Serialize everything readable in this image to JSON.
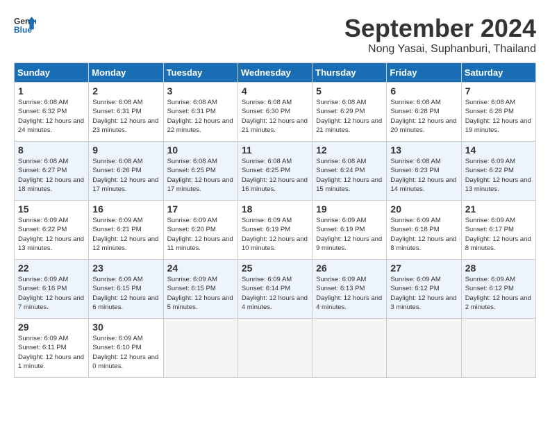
{
  "header": {
    "logo_line1": "General",
    "logo_line2": "Blue",
    "month_title": "September 2024",
    "location": "Nong Yasai, Suphanburi, Thailand"
  },
  "weekdays": [
    "Sunday",
    "Monday",
    "Tuesday",
    "Wednesday",
    "Thursday",
    "Friday",
    "Saturday"
  ],
  "weeks": [
    [
      {
        "day": "1",
        "sunrise": "6:08 AM",
        "sunset": "6:32 PM",
        "daylight": "12 hours and 24 minutes."
      },
      {
        "day": "2",
        "sunrise": "6:08 AM",
        "sunset": "6:31 PM",
        "daylight": "12 hours and 23 minutes."
      },
      {
        "day": "3",
        "sunrise": "6:08 AM",
        "sunset": "6:31 PM",
        "daylight": "12 hours and 22 minutes."
      },
      {
        "day": "4",
        "sunrise": "6:08 AM",
        "sunset": "6:30 PM",
        "daylight": "12 hours and 21 minutes."
      },
      {
        "day": "5",
        "sunrise": "6:08 AM",
        "sunset": "6:29 PM",
        "daylight": "12 hours and 21 minutes."
      },
      {
        "day": "6",
        "sunrise": "6:08 AM",
        "sunset": "6:28 PM",
        "daylight": "12 hours and 20 minutes."
      },
      {
        "day": "7",
        "sunrise": "6:08 AM",
        "sunset": "6:28 PM",
        "daylight": "12 hours and 19 minutes."
      }
    ],
    [
      {
        "day": "8",
        "sunrise": "6:08 AM",
        "sunset": "6:27 PM",
        "daylight": "12 hours and 18 minutes."
      },
      {
        "day": "9",
        "sunrise": "6:08 AM",
        "sunset": "6:26 PM",
        "daylight": "12 hours and 17 minutes."
      },
      {
        "day": "10",
        "sunrise": "6:08 AM",
        "sunset": "6:25 PM",
        "daylight": "12 hours and 17 minutes."
      },
      {
        "day": "11",
        "sunrise": "6:08 AM",
        "sunset": "6:25 PM",
        "daylight": "12 hours and 16 minutes."
      },
      {
        "day": "12",
        "sunrise": "6:08 AM",
        "sunset": "6:24 PM",
        "daylight": "12 hours and 15 minutes."
      },
      {
        "day": "13",
        "sunrise": "6:08 AM",
        "sunset": "6:23 PM",
        "daylight": "12 hours and 14 minutes."
      },
      {
        "day": "14",
        "sunrise": "6:09 AM",
        "sunset": "6:22 PM",
        "daylight": "12 hours and 13 minutes."
      }
    ],
    [
      {
        "day": "15",
        "sunrise": "6:09 AM",
        "sunset": "6:22 PM",
        "daylight": "12 hours and 13 minutes."
      },
      {
        "day": "16",
        "sunrise": "6:09 AM",
        "sunset": "6:21 PM",
        "daylight": "12 hours and 12 minutes."
      },
      {
        "day": "17",
        "sunrise": "6:09 AM",
        "sunset": "6:20 PM",
        "daylight": "12 hours and 11 minutes."
      },
      {
        "day": "18",
        "sunrise": "6:09 AM",
        "sunset": "6:19 PM",
        "daylight": "12 hours and 10 minutes."
      },
      {
        "day": "19",
        "sunrise": "6:09 AM",
        "sunset": "6:19 PM",
        "daylight": "12 hours and 9 minutes."
      },
      {
        "day": "20",
        "sunrise": "6:09 AM",
        "sunset": "6:18 PM",
        "daylight": "12 hours and 8 minutes."
      },
      {
        "day": "21",
        "sunrise": "6:09 AM",
        "sunset": "6:17 PM",
        "daylight": "12 hours and 8 minutes."
      }
    ],
    [
      {
        "day": "22",
        "sunrise": "6:09 AM",
        "sunset": "6:16 PM",
        "daylight": "12 hours and 7 minutes."
      },
      {
        "day": "23",
        "sunrise": "6:09 AM",
        "sunset": "6:15 PM",
        "daylight": "12 hours and 6 minutes."
      },
      {
        "day": "24",
        "sunrise": "6:09 AM",
        "sunset": "6:15 PM",
        "daylight": "12 hours and 5 minutes."
      },
      {
        "day": "25",
        "sunrise": "6:09 AM",
        "sunset": "6:14 PM",
        "daylight": "12 hours and 4 minutes."
      },
      {
        "day": "26",
        "sunrise": "6:09 AM",
        "sunset": "6:13 PM",
        "daylight": "12 hours and 4 minutes."
      },
      {
        "day": "27",
        "sunrise": "6:09 AM",
        "sunset": "6:12 PM",
        "daylight": "12 hours and 3 minutes."
      },
      {
        "day": "28",
        "sunrise": "6:09 AM",
        "sunset": "6:12 PM",
        "daylight": "12 hours and 2 minutes."
      }
    ],
    [
      {
        "day": "29",
        "sunrise": "6:09 AM",
        "sunset": "6:11 PM",
        "daylight": "12 hours and 1 minute."
      },
      {
        "day": "30",
        "sunrise": "6:09 AM",
        "sunset": "6:10 PM",
        "daylight": "12 hours and 0 minutes."
      },
      null,
      null,
      null,
      null,
      null
    ]
  ]
}
